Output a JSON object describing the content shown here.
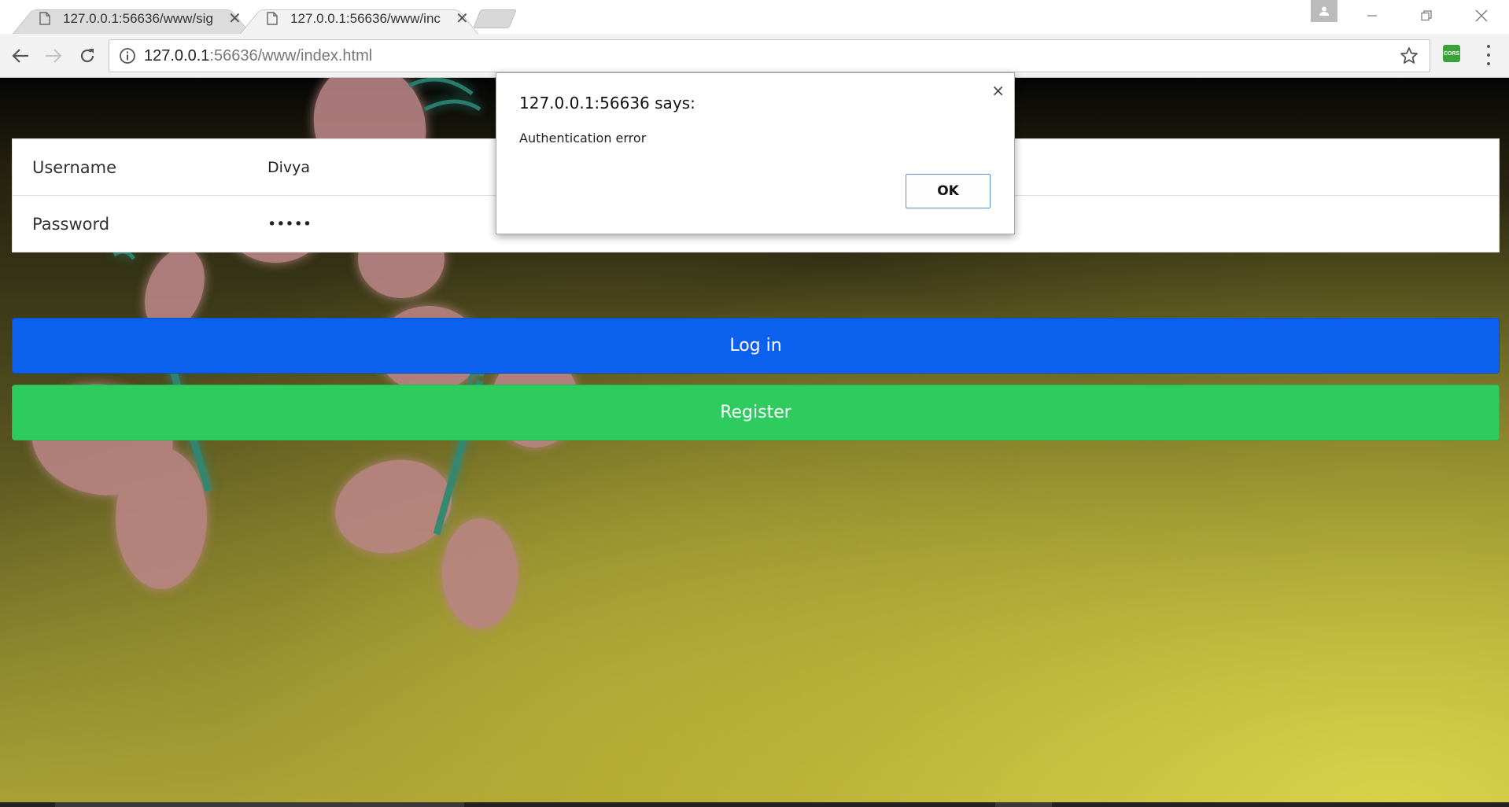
{
  "browser": {
    "tabs": [
      {
        "title": "127.0.0.1:56636/www/sig",
        "active": false
      },
      {
        "title": "127.0.0.1:56636/www/inc",
        "active": true
      }
    ],
    "close_glyph": "✕",
    "address": {
      "host": "127.0.0.1",
      "rest": ":56636/www/index.html"
    },
    "extension_label": "CORS"
  },
  "form": {
    "username_label": "Username",
    "username_value": "Divya",
    "password_label": "Password",
    "password_value": "•••••"
  },
  "buttons": {
    "login": "Log in",
    "register": "Register"
  },
  "dialog": {
    "title": "127.0.0.1:56636 says:",
    "message": "Authentication error",
    "ok": "OK",
    "close": "×"
  },
  "colors": {
    "login": "#0c60ee",
    "register": "#2ecc5f"
  }
}
